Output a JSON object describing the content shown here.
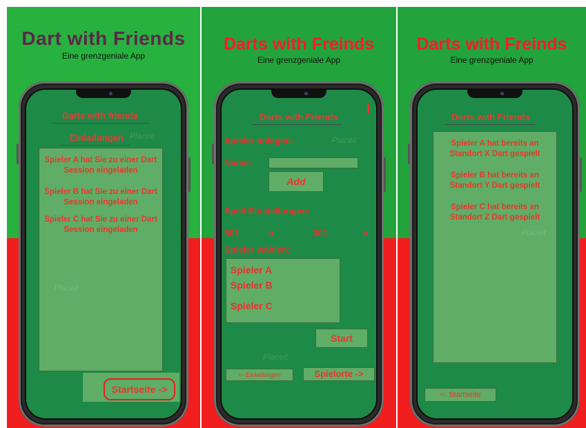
{
  "panels": [
    {
      "title": "Dart with Friends",
      "subtitle": "Eine grenzgeniale App",
      "screen": {
        "header": "Darts with friends",
        "section": "Einladungen",
        "invites": [
          "Spieler A hat Sie zu einer Dart Session eingeladen",
          "Spieler B hat Sie zu einer Dart Session eingeladen",
          "Spieler C hat Sie zu einer Dart Session eingeladen"
        ],
        "home_button": "Startseite ->"
      }
    },
    {
      "title": "Darts with Freinds",
      "subtitle": "Eine grenzgeniale App",
      "screen": {
        "header": "Darts with Friends",
        "create_label": "Spieler anlegen:",
        "name_label": "Name:",
        "add_button": "Add",
        "settings_label": "Spiel Einstellungen:",
        "mode_501": "501",
        "mode_301": "301",
        "radio_mark": "o",
        "choose_label": "Spieler wählen:",
        "players": [
          "Spieler A",
          "Spieler B",
          "Spieler C"
        ],
        "start_button": "Start",
        "back_button": "<- Einladungen",
        "next_button": "Spielorte ->"
      }
    },
    {
      "title": "Darts with Freinds",
      "subtitle": "Eine grenzgeniale App",
      "screen": {
        "header": "Darts with Friends",
        "locations": [
          "Spieler A hat bereits an Standort X Dart gespielt",
          "Spieler B hat bereits an Standort Y Dart gespielt",
          "Spieler C hat bereits an Standort Z Dart gespielt"
        ],
        "back_button": "<- Startseite"
      }
    }
  ],
  "colors": {
    "green": "#23a33c",
    "red": "#f01e1e",
    "screen": "#1e8a47",
    "box": "#5fad66",
    "text_red": "#e8372f",
    "title_purple": "#5b2848"
  }
}
